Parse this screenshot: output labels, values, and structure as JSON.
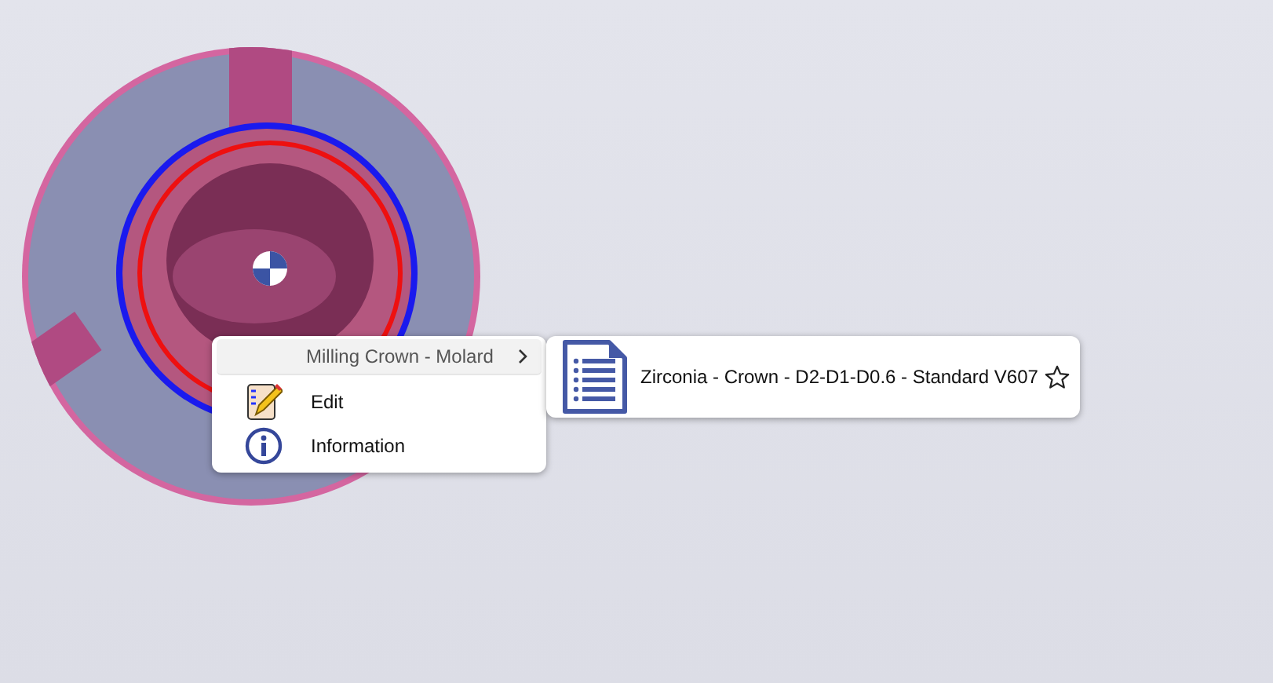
{
  "context_menu": {
    "items": [
      {
        "kind": "submenu",
        "label": "Milling Crown - Molard",
        "selected": true
      },
      {
        "kind": "edit",
        "label": "Edit",
        "selected": false
      },
      {
        "kind": "info",
        "label": "Information",
        "selected": false
      }
    ]
  },
  "submenu": {
    "items": [
      {
        "label": "Zirconia - Crown - D2-D1-D0.6 - Standard V607",
        "favorite": false
      }
    ]
  }
}
